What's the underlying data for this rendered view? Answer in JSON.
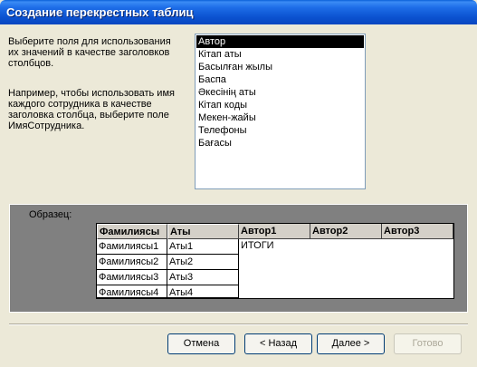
{
  "window": {
    "title": "Создание перекрестных таблиц"
  },
  "description": {
    "line1": "Выберите поля для использования",
    "line2": "их значений в качестве заголовков",
    "line3": "столбцов.",
    "line4": "Например, чтобы использовать имя",
    "line5": "каждого сотрудника в качестве",
    "line6": "заголовка столбца, выберите поле",
    "line7": "ИмяСотрудника."
  },
  "fields": [
    "Автор",
    "Кітап аты",
    "Басылған жылы",
    "Баспа",
    "Әкесінің аты",
    "Кітап коды",
    "Мекен-жайы",
    "Телефоны",
    "Бағасы"
  ],
  "selected_field": "Автор",
  "sample": {
    "label": "Образец:",
    "row_headers": [
      "Фамилиясы",
      "Аты"
    ],
    "column_headers": [
      "Автор1",
      "Автор2",
      "Автор3"
    ],
    "rows": [
      [
        "Фамилиясы1",
        "Аты1"
      ],
      [
        "Фамилиясы2",
        "Аты2"
      ],
      [
        "Фамилиясы3",
        "Аты3"
      ],
      [
        "Фамилиясы4",
        "Аты4"
      ]
    ],
    "total_label": "ИТОГИ"
  },
  "buttons": {
    "cancel": "Отмена",
    "back": "< Назад",
    "next": "Далее >",
    "finish": "Готово"
  }
}
